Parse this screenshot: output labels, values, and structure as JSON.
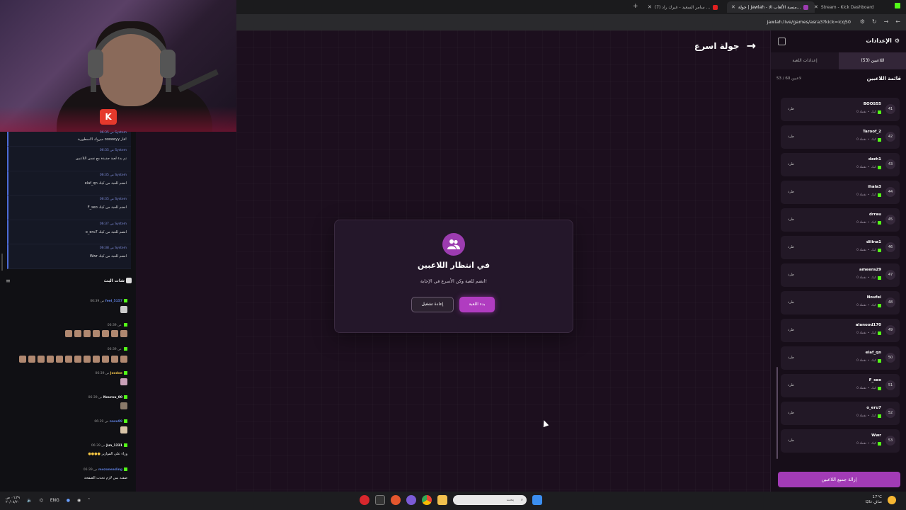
{
  "browser": {
    "tabs": [
      {
        "label": "Stream - Kick Dashboard",
        "active": false
      },
      {
        "label": "جولة | Jawlah - منصة الألعاب الا...",
        "active": true
      },
      {
        "label": "(7) سامر السعيد - غيرك راد ...",
        "active": false
      }
    ],
    "url": "jawlah.live/games/asra3?kick=icq50"
  },
  "left_chat": {
    "system_messages": [
      {
        "time": "06:35 ص",
        "author": "System",
        "text": "ميروك الاسطورية oooeeyy فاز!"
      },
      {
        "time": "06:35 ص",
        "author": "System",
        "text": "تم بدء لعبة جديدة مع نفس اللاعبين"
      },
      {
        "time": "06:35 ص",
        "author": "System",
        "text": "elaf_qn انضم للعبة من كيك"
      },
      {
        "time": "06:35 ص",
        "author": "System",
        "text": "F_seo انضم للعبة من كيك"
      },
      {
        "time": "06:37 ص",
        "author": "System",
        "text": "o_eru7 انضم للعبة من كيك"
      },
      {
        "time": "06:38 ص",
        "author": "System",
        "text": "Wwr انضم للعبة من كيك"
      }
    ],
    "chat_title": "شات البث",
    "chat_messages": [
      {
        "time": "06:39 ص",
        "user": "feel_5157",
        "color": "#5b7bd6",
        "text": ""
      },
      {
        "time": "06:39 ص",
        "user": "",
        "color": "#e03a6a",
        "text": ""
      },
      {
        "time": "06:39 ص",
        "user": "",
        "color": "#e03a6a",
        "text": ""
      },
      {
        "time": "06:39 ص",
        "user": "Joodoe",
        "color": "#f0c24a",
        "text": ""
      },
      {
        "time": "06:39 ص",
        "user": "Nourou_00",
        "color": "#eee",
        "text": ""
      },
      {
        "time": "06:39 ص",
        "user": "nasu99",
        "color": "#5b7bd6",
        "text": ""
      },
      {
        "time": "06:39 ص",
        "user": "Jun_1231",
        "color": "#eee",
        "text": "وراء على الفوازير"
      },
      {
        "time": "06:39 ص",
        "user": "mozoneading",
        "color": "#5b7bd6",
        "text": "ضفته بس لازم تحدث الصفحة"
      }
    ]
  },
  "game": {
    "back_label": "جولة اسرع",
    "card_title": "في انتظار اللاعبين",
    "card_subtitle": "انضم للعبة وكن الأسرع في الإجابة!",
    "start_button": "بدء اللعبة",
    "restart_button": "إعادة تشغيل"
  },
  "settings_panel": {
    "title": "الإعدادات",
    "tabs": [
      {
        "label": "اللاعبين (53)",
        "active": true
      },
      {
        "label": "إعدادات اللعبة",
        "active": false
      }
    ],
    "list_title": "قائمة اللاعبين",
    "list_count": "53 / 60 لاعبين",
    "kick_label": "طرد",
    "points_label": "0 نقطة",
    "source_label": "كيك",
    "players": [
      {
        "num": "41",
        "name": "BOOS55"
      },
      {
        "num": "42",
        "name": "Taroof_2"
      },
      {
        "num": "43",
        "name": "dzzh1"
      },
      {
        "num": "44",
        "name": "ihala3"
      },
      {
        "num": "45",
        "name": "drrau"
      },
      {
        "num": "46",
        "name": "diiina1"
      },
      {
        "num": "47",
        "name": "ameera29"
      },
      {
        "num": "48",
        "name": "Noufei"
      },
      {
        "num": "49",
        "name": "alanood170"
      },
      {
        "num": "50",
        "name": "elaf_qn"
      },
      {
        "num": "51",
        "name": "F_seo"
      },
      {
        "num": "52",
        "name": "o_eru7"
      },
      {
        "num": "53",
        "name": "Wwr"
      }
    ],
    "remove_all_button": "إزالة جميع اللاعبين"
  },
  "taskbar": {
    "time": "٠٦:٣٩ ص",
    "date": "٢٠/٠٨/٢٠",
    "lang": "ENG",
    "search_placeholder": "بحث",
    "weather_temp": "17°C",
    "weather_desc": "صافٍ غالبًا"
  }
}
